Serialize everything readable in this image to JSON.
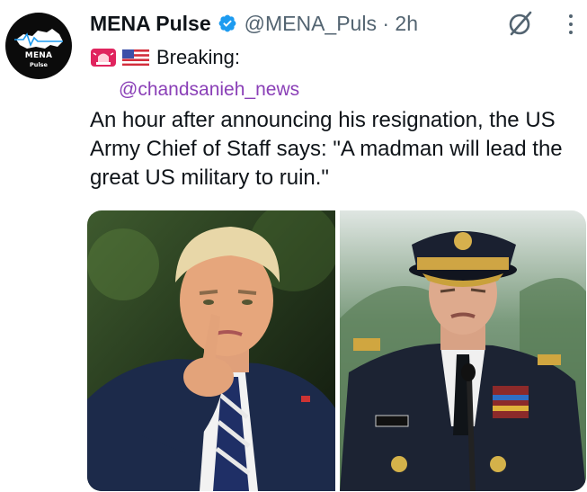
{
  "account": {
    "display_name": "MENA Pulse",
    "handle": "@MENA_Puls",
    "separator": "·",
    "time": "2h",
    "avatar_line1": "MENA",
    "avatar_line2": "Pulse"
  },
  "tweet": {
    "prefix_emojis": [
      "siren-emoji",
      "us-flag-emoji"
    ],
    "breaking_label": "Breaking:",
    "mention": "@chandsanieh_news",
    "body": "An hour after announcing his resignation, the US Army Chief of Staff says: \"A madman will lead the great US military to ruin.\""
  },
  "icons": {
    "verified": "verified-badge-icon",
    "grok": "grok-icon",
    "more": "more-options-icon"
  },
  "colors": {
    "verified_blue": "#1d9bf0",
    "mention_purple": "#8a3fb7",
    "secondary_text": "#536471"
  }
}
